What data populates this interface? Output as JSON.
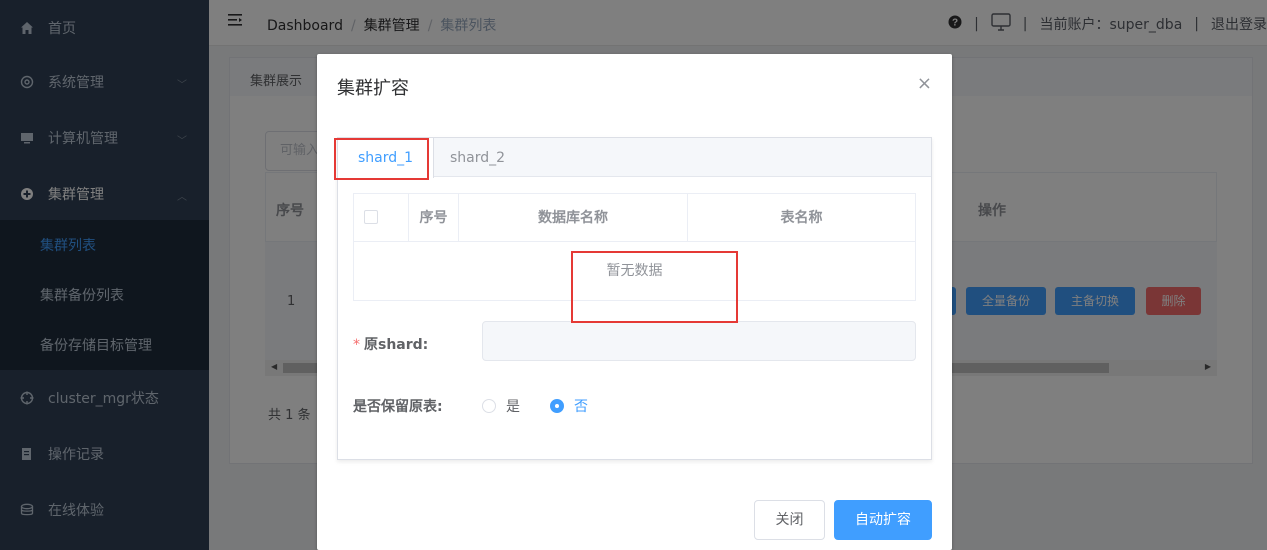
{
  "sidebar": {
    "items": [
      {
        "label": "首页",
        "icon": "home-icon"
      },
      {
        "label": "系统管理",
        "icon": "gear-icon"
      },
      {
        "label": "计算机管理",
        "icon": "monitor-icon"
      },
      {
        "label": "集群管理",
        "icon": "cluster-icon"
      },
      {
        "label": "cluster_mgr状态",
        "icon": "crosshair-icon"
      },
      {
        "label": "操作记录",
        "icon": "record-icon"
      },
      {
        "label": "在线体验",
        "icon": "database-icon"
      }
    ],
    "subitems": [
      {
        "label": "集群列表"
      },
      {
        "label": "集群备份列表"
      },
      {
        "label": "备份存储目标管理"
      }
    ]
  },
  "topbar": {
    "breadcrumb": [
      "Dashboard",
      "集群管理",
      "集群列表"
    ],
    "account_label": "当前账户：super_dba",
    "logout_label": "退出登录"
  },
  "background": {
    "tab_label": "集群展示",
    "search_placeholder": "可输入",
    "col_index": "序号",
    "col_ops": "操作",
    "row_index": "1",
    "buttons": [
      {
        "label": "全量备份",
        "color": "#409eff"
      },
      {
        "label": "主备切换",
        "color": "#409eff"
      },
      {
        "label": "删除",
        "color": "#f56c6c"
      }
    ],
    "total": "共 1 条"
  },
  "dialog": {
    "title": "集群扩容",
    "tabs": [
      "shard_1",
      "shard_2"
    ],
    "table": {
      "headers": [
        "序号",
        "数据库名称",
        "表名称"
      ],
      "empty_text": "暂无数据"
    },
    "origin_shard_label": "原shard:",
    "keep_table_label": "是否保留原表:",
    "radio_yes": "是",
    "radio_no": "否",
    "keep_table_value": "否",
    "close_button": "关闭",
    "confirm_button": "自动扩容"
  },
  "colors": {
    "primary": "#409eff",
    "danger": "#f56c6c",
    "sidebar_bg": "#304156",
    "highlight": "#e53935"
  }
}
